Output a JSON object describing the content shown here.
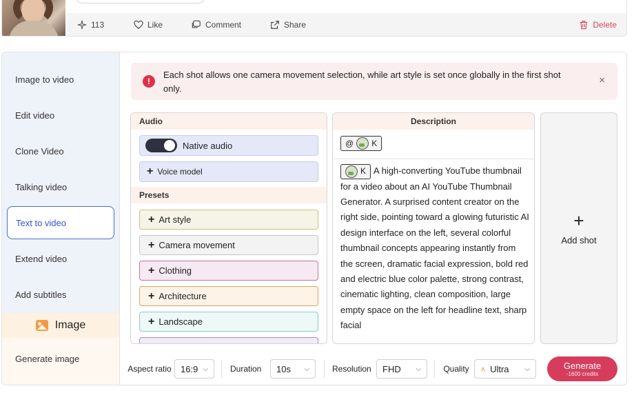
{
  "post": {
    "views": "113",
    "like": "Like",
    "comment": "Comment",
    "share": "Share",
    "delete": "Delete"
  },
  "sidebar": {
    "items": [
      {
        "label": "Image to video"
      },
      {
        "label": "Edit video"
      },
      {
        "label": "Clone Video"
      },
      {
        "label": "Talking video"
      },
      {
        "label": "Text to video"
      },
      {
        "label": "Extend video"
      },
      {
        "label": "Add subtitles"
      }
    ],
    "image_section": "Image",
    "generate_image": "Generate image"
  },
  "alert": {
    "text": "Each shot allows one camera movement selection, while art style is set once globally in the first shot only.",
    "close": "×"
  },
  "audio": {
    "header": "Audio",
    "native_audio": "Native audio",
    "native_audio_on": true,
    "voice_model": "Voice model"
  },
  "presets": {
    "header": "Presets",
    "items": [
      {
        "label": "Art style"
      },
      {
        "label": "Camera movement"
      },
      {
        "label": "Clothing"
      },
      {
        "label": "Architecture"
      },
      {
        "label": "Landscape"
      }
    ]
  },
  "description": {
    "header": "Description",
    "mention_prefix": "@",
    "chip_label": "K",
    "text": "A high-converting YouTube thumbnail for a video about an AI YouTube Thumbnail Generator. A surprised content creator on the right side, pointing toward a glowing futuristic AI design interface on the left, several colorful thumbnail concepts appearing instantly from the screen, dramatic facial expression, bold red and electric blue color palette, strong contrast, cinematic lighting, clean composition, large empty space on the left for headline text, sharp facial"
  },
  "add_shot": "Add shot",
  "controls": {
    "aspect_label": "Aspect ratio",
    "aspect_value": "16:9",
    "duration_label": "Duration",
    "duration_value": "10s",
    "resolution_label": "Resolution",
    "resolution_value": "FHD",
    "quality_label": "Quality",
    "quality_value": "Ultra",
    "generate": "Generate",
    "credits": "-1600 credits"
  },
  "colors": {
    "accent": "#d63d5d",
    "active_nav": "#2f56c9",
    "alert_bg": "#fbeeee"
  }
}
